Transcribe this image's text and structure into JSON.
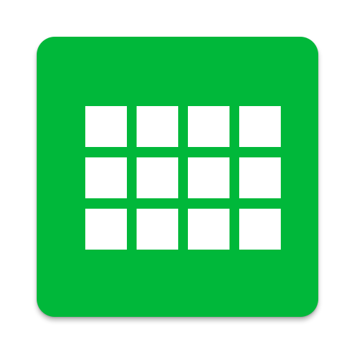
{
  "app_icon": {
    "icon_name": "grid-calendar-icon",
    "background_color": "#00B83A",
    "tile_color": "#FFFFFF",
    "rows": 3,
    "columns": 4
  }
}
